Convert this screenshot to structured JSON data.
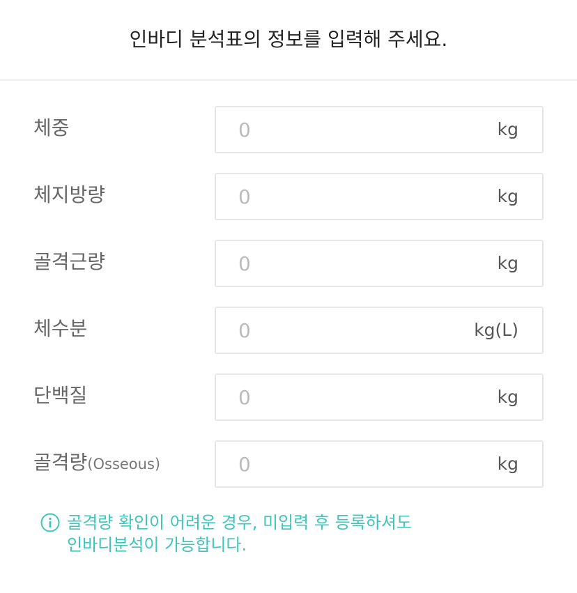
{
  "header": {
    "title": "인바디 분석표의 정보를 입력해 주세요."
  },
  "fields": [
    {
      "label": "체중",
      "label_sub": "",
      "placeholder": "0",
      "value": "",
      "unit": "kg"
    },
    {
      "label": "체지방량",
      "label_sub": "",
      "placeholder": "0",
      "value": "",
      "unit": "kg"
    },
    {
      "label": "골격근량",
      "label_sub": "",
      "placeholder": "0",
      "value": "",
      "unit": "kg"
    },
    {
      "label": "체수분",
      "label_sub": "",
      "placeholder": "0",
      "value": "",
      "unit": "kg(L)"
    },
    {
      "label": "단백질",
      "label_sub": "",
      "placeholder": "0",
      "value": "",
      "unit": "kg"
    },
    {
      "label": "골격량",
      "label_sub": "(Osseous)",
      "placeholder": "0",
      "value": "",
      "unit": "kg"
    }
  ],
  "notice": {
    "icon": "info-icon",
    "line1": "골격량 확인이 어려운 경우, 미입력 후 등록하셔도",
    "line2": "인바디분석이 가능합니다."
  },
  "colors": {
    "accent": "#3cc5bb",
    "border": "#e6e6e6",
    "label": "#666666",
    "placeholder": "#bbbbbb"
  }
}
